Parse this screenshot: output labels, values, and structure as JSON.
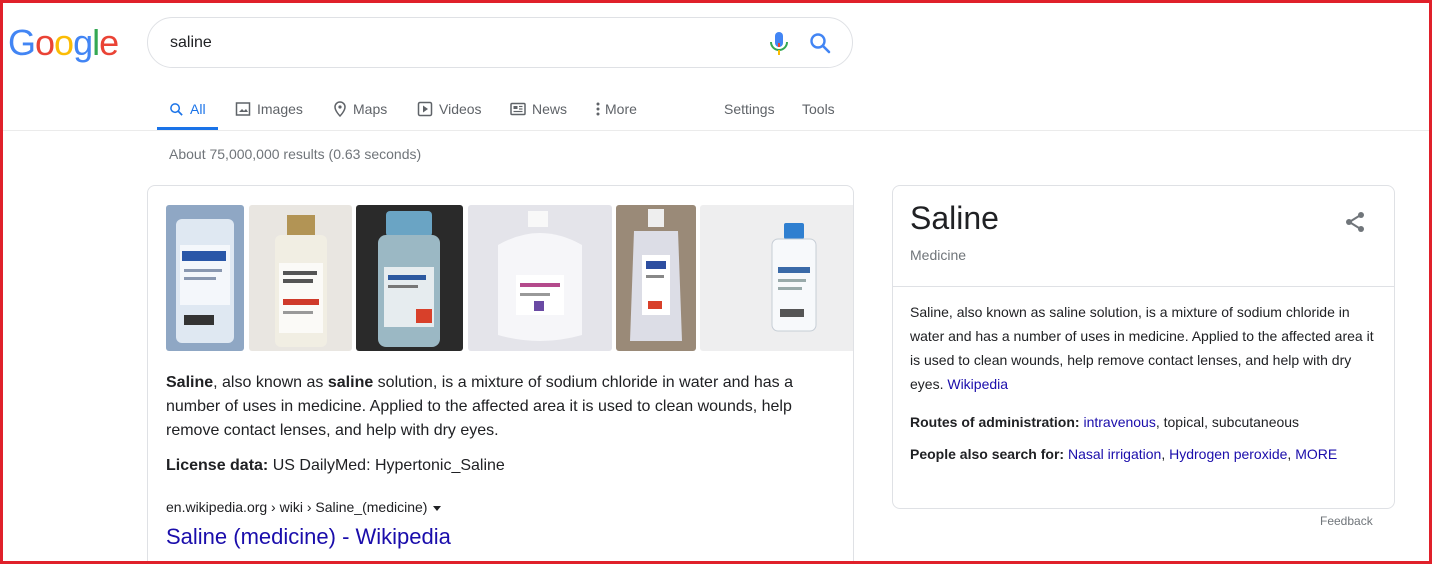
{
  "logo": {
    "text": "Google",
    "letters": [
      "G",
      "o",
      "o",
      "g",
      "l",
      "e"
    ],
    "colors": [
      "#4285f4",
      "#ea4335",
      "#fbbc05",
      "#4285f4",
      "#34a853",
      "#ea4335"
    ]
  },
  "search": {
    "query": "saline",
    "mic_icon": "mic-icon",
    "search_icon": "search-icon"
  },
  "tabs": [
    {
      "label": "All",
      "icon": "search-icon",
      "active": true
    },
    {
      "label": "Images",
      "icon": "image-icon"
    },
    {
      "label": "Maps",
      "icon": "map-pin-icon"
    },
    {
      "label": "Videos",
      "icon": "play-icon"
    },
    {
      "label": "News",
      "icon": "newspaper-icon"
    },
    {
      "label": "More",
      "icon": "more-vert-icon"
    },
    {
      "label": "Settings"
    },
    {
      "label": "Tools"
    }
  ],
  "stats": "About 75,000,000 results (0.63 seconds)",
  "result": {
    "desc_b1": "Saline",
    "desc_t1": ", also known as ",
    "desc_b2": "saline",
    "desc_t2": " solution, is a mixture of sodium chloride in water and has a number of uses in medicine. Applied to the affected area it is used to clean wounds, help remove contact lenses, and help with dry eyes.",
    "license_label": "License data:",
    "license_value": " US DailyMed: Hypertonic_Saline",
    "breadcrumb": "en.wikipedia.org › wiki › Saline_(medicine)",
    "title": "Saline (medicine) - Wikipedia"
  },
  "panel": {
    "title": "Saline",
    "subtitle": "Medicine",
    "description": "Saline, also known as saline solution, is a mixture of sodium chloride in water and has a number of uses in medicine. Applied to the affected area it is used to clean wounds, help remove contact lenses, and help with dry eyes.",
    "source": "Wikipedia",
    "routes_label": "Routes of administration:",
    "routes_link": "intravenous",
    "routes_rest": ", topical, subcutaneous",
    "also_label": "People also search for:",
    "also_link1": "Nasal irrigation",
    "also_link2": "Hydrogen peroxide",
    "also_more": "MORE"
  },
  "feedback": "Feedback",
  "colors": {
    "accent": "#1a73e8",
    "link": "#1a0dab",
    "frame": "#e0202a"
  }
}
